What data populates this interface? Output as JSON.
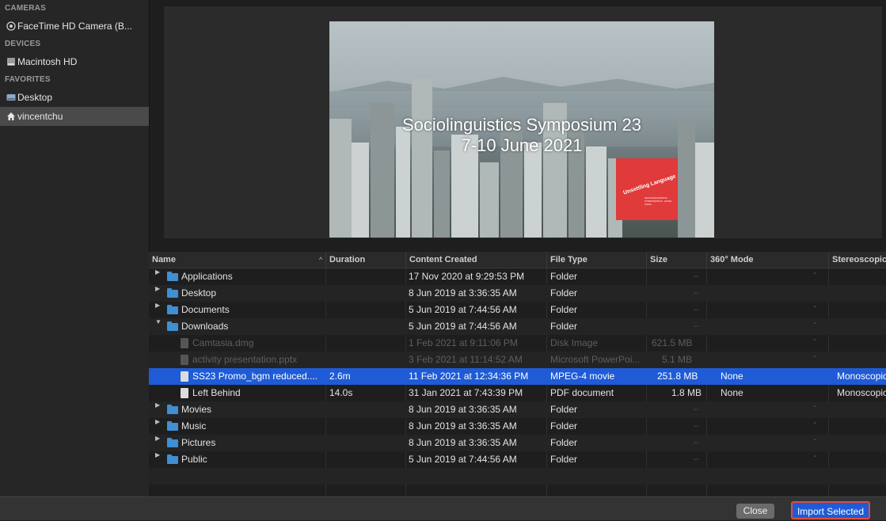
{
  "sidebar": {
    "sections": [
      {
        "title": "CAMERAS",
        "items": [
          {
            "label": "FaceTime HD Camera (B...",
            "icon": "camera-icon"
          }
        ]
      },
      {
        "title": "DEVICES",
        "items": [
          {
            "label": "Macintosh HD",
            "icon": "hard-drive-icon"
          }
        ]
      },
      {
        "title": "FAVORITES",
        "items": [
          {
            "label": "Desktop",
            "icon": "desktop-icon"
          },
          {
            "label": "vincentchu",
            "icon": "home-icon"
          }
        ]
      }
    ],
    "selected": "vincentchu"
  },
  "preview": {
    "title_line1": "Sociolinguistics Symposium 23",
    "title_line2": "7-10 June 2021",
    "logo_text": "Unsettling Language",
    "logo_small": "SOCIOLINGUISTICS SYMPOSIUM 23 · HONG KONG"
  },
  "table": {
    "columns": [
      "Name",
      "Duration",
      "Content Created",
      "File Type",
      "Size",
      "360° Mode",
      "Stereoscopic M"
    ],
    "sort_indicator": "^",
    "rows": [
      {
        "name": "Applications",
        "duration": "",
        "created": "17 Nov 2020 at 9:29:53 PM",
        "type": "Folder",
        "size": "--",
        "mode": "",
        "stereo": ""
      },
      {
        "name": "Desktop",
        "duration": "",
        "created": "8 Jun 2019 at 3:36:35 AM",
        "type": "Folder",
        "size": "--",
        "mode": "",
        "stereo": ""
      },
      {
        "name": "Documents",
        "duration": "",
        "created": "5 Jun 2019 at 7:44:56 AM",
        "type": "Folder",
        "size": "--",
        "mode": "",
        "stereo": ""
      },
      {
        "name": "Downloads",
        "duration": "",
        "created": "5 Jun 2019 at 7:44:56 AM",
        "type": "Folder",
        "size": "--",
        "mode": "",
        "stereo": ""
      },
      {
        "name": "Camtasia.dmg",
        "duration": "",
        "created": "1 Feb 2021 at 9:11:06 PM",
        "type": "Disk Image",
        "size": "621.5 MB",
        "mode": "",
        "stereo": ""
      },
      {
        "name": "activity presentation.pptx",
        "duration": "",
        "created": "3 Feb 2021 at 11:14:52 AM",
        "type": "Microsoft PowerPoi...",
        "size": "5.1 MB",
        "mode": "",
        "stereo": ""
      },
      {
        "name": "SS23 Promo_bgm reduced....",
        "duration": "2.6m",
        "created": "11 Feb 2021 at 12:34:36 PM",
        "type": "MPEG-4 movie",
        "size": "251.8 MB",
        "mode": "None",
        "stereo": "Monoscopic"
      },
      {
        "name": "Left Behind",
        "duration": "14.0s",
        "created": "31 Jan 2021 at 7:43:39 PM",
        "type": "PDF document",
        "size": "1.8 MB",
        "mode": "None",
        "stereo": "Monoscopic"
      },
      {
        "name": "Movies",
        "duration": "",
        "created": "8 Jun 2019 at 3:36:35 AM",
        "type": "Folder",
        "size": "--",
        "mode": "",
        "stereo": ""
      },
      {
        "name": "Music",
        "duration": "",
        "created": "8 Jun 2019 at 3:36:35 AM",
        "type": "Folder",
        "size": "--",
        "mode": "",
        "stereo": ""
      },
      {
        "name": "Pictures",
        "duration": "",
        "created": "8 Jun 2019 at 3:36:35 AM",
        "type": "Folder",
        "size": "--",
        "mode": "",
        "stereo": ""
      },
      {
        "name": "Public",
        "duration": "",
        "created": "5 Jun 2019 at 7:44:56 AM",
        "type": "Folder",
        "size": "--",
        "mode": "",
        "stereo": ""
      }
    ]
  },
  "footer": {
    "close_label": "Close",
    "import_label": "Import Selected"
  },
  "colors": {
    "selection": "#1f5bd6",
    "highlight_border": "#e14b3b",
    "folder": "#3f8fd2"
  }
}
